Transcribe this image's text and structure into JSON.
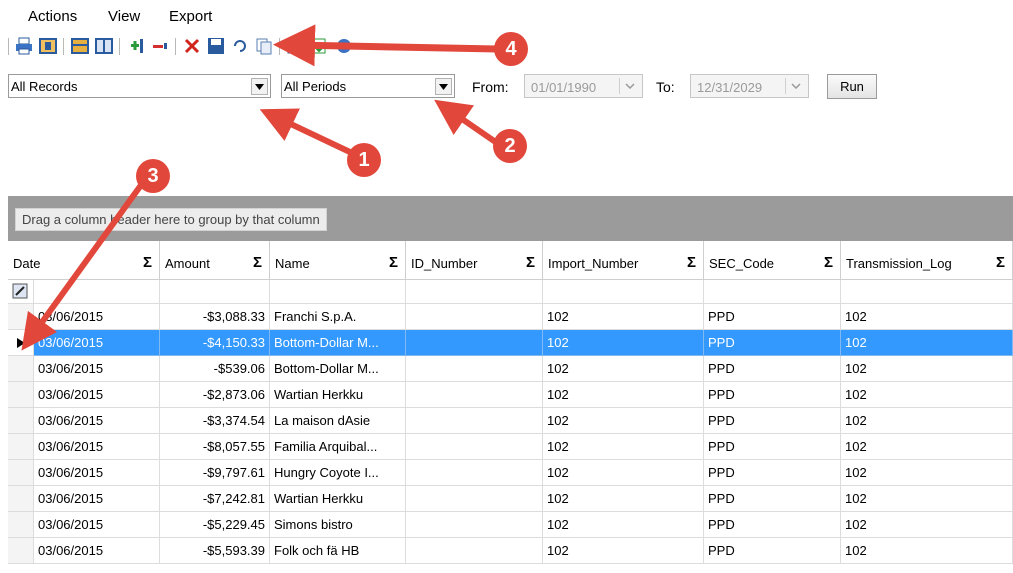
{
  "menu": {
    "items": [
      "Actions",
      "View",
      "Export"
    ]
  },
  "toolbar": {
    "buttons": [
      "print-icon",
      "layout-icon",
      "grid-icon",
      "grid-alt-icon",
      "add-row-icon",
      "remove-row-icon",
      "delete-icon",
      "save-icon",
      "undo-icon",
      "copy-icon",
      "table-icon",
      "export-icon",
      "refresh-icon"
    ]
  },
  "filters": {
    "records": "All Records",
    "periods": "All Periods",
    "from_label": "From:",
    "from_value": "01/01/1990",
    "to_label": "To:",
    "to_value": "12/31/2029",
    "run_label": "Run"
  },
  "group_panel": {
    "text": "Drag a column header here to group by that column"
  },
  "grid": {
    "columns": [
      "Date",
      "Amount",
      "Name",
      "ID_Number",
      "Import_Number",
      "SEC_Code",
      "Transmission_Log"
    ],
    "sigma": "Σ",
    "rows": [
      [
        "03/06/2015",
        "-$3,088.33",
        "Franchi S.p.A.",
        "",
        "102",
        "PPD",
        "102"
      ],
      [
        "03/06/2015",
        "-$4,150.33",
        "Bottom-Dollar M...",
        "",
        "102",
        "PPD",
        "102"
      ],
      [
        "03/06/2015",
        "-$539.06",
        "Bottom-Dollar M...",
        "",
        "102",
        "PPD",
        "102"
      ],
      [
        "03/06/2015",
        "-$2,873.06",
        "Wartian Herkku",
        "",
        "102",
        "PPD",
        "102"
      ],
      [
        "03/06/2015",
        "-$3,374.54",
        "La maison dAsie",
        "",
        "102",
        "PPD",
        "102"
      ],
      [
        "03/06/2015",
        "-$8,057.55",
        "Familia Arquibal...",
        "",
        "102",
        "PPD",
        "102"
      ],
      [
        "03/06/2015",
        "-$9,797.61",
        "Hungry Coyote I...",
        "",
        "102",
        "PPD",
        "102"
      ],
      [
        "03/06/2015",
        "-$7,242.81",
        "Wartian Herkku",
        "",
        "102",
        "PPD",
        "102"
      ],
      [
        "03/06/2015",
        "-$5,229.45",
        "Simons bistro",
        "",
        "102",
        "PPD",
        "102"
      ],
      [
        "03/06/2015",
        "-$5,593.39",
        "Folk och fä HB",
        "",
        "102",
        "PPD",
        "102"
      ]
    ],
    "selected_row": 1
  },
  "annotations": [
    "1",
    "2",
    "3",
    "4"
  ],
  "colors": {
    "selection": "#3399ff",
    "annotation": "#e2473b",
    "group_panel": "#9b9b9b"
  }
}
